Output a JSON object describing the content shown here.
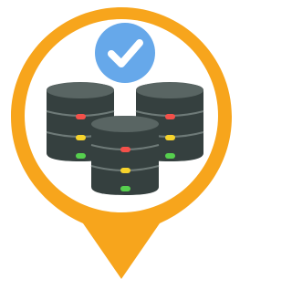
{
  "icon": {
    "name": "database-verified-location-pin",
    "badge_icon": "check-mark-icon",
    "server_icon": "database-server-icon"
  },
  "colors": {
    "pin_orange": "#F7A51C",
    "inner_white": "#FFFFFF",
    "check_badge_blue": "#66A8EA",
    "check_mark_white": "#FFFFFF",
    "server_dark": "#35403F",
    "server_top": "#596563",
    "server_stroke": "#6E7A78",
    "led_red": "#F4504A",
    "led_yellow": "#F6D32C",
    "led_green": "#56CF4E"
  }
}
